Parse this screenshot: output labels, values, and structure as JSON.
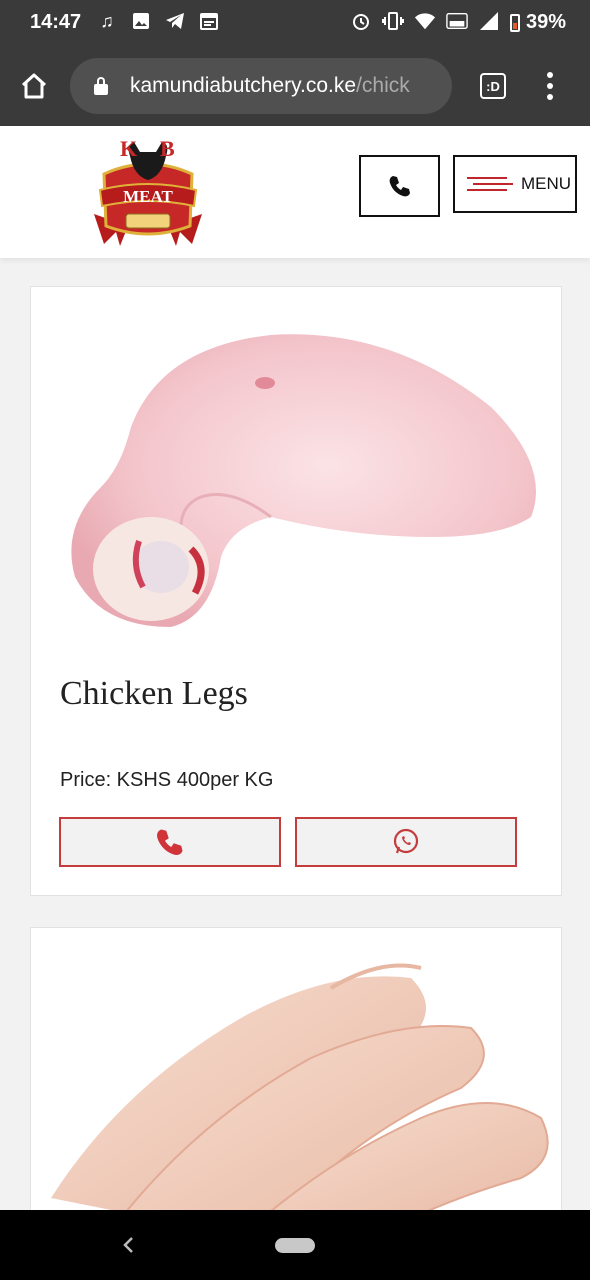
{
  "status_bar": {
    "time": "14:47",
    "battery": "39%",
    "left_icons": [
      "music-icon",
      "image-icon",
      "telegram-icon",
      "calendar-icon"
    ],
    "right_icons": [
      "alarm-icon",
      "vibrate-icon",
      "wifi-icon",
      "volte-icon",
      "signal-icon"
    ]
  },
  "browser": {
    "url_host": "kamundiabutchery.co.ke",
    "url_path": "/chick",
    "tabs_label": ":D"
  },
  "header": {
    "menu_label": "MENU",
    "accent_color": "#c0272d"
  },
  "products": [
    {
      "title": "Chicken Legs",
      "price": "Price: KSHS 400per KG",
      "image": "chicken-leg-photo"
    },
    {
      "image": "chicken-wings-photo"
    }
  ]
}
